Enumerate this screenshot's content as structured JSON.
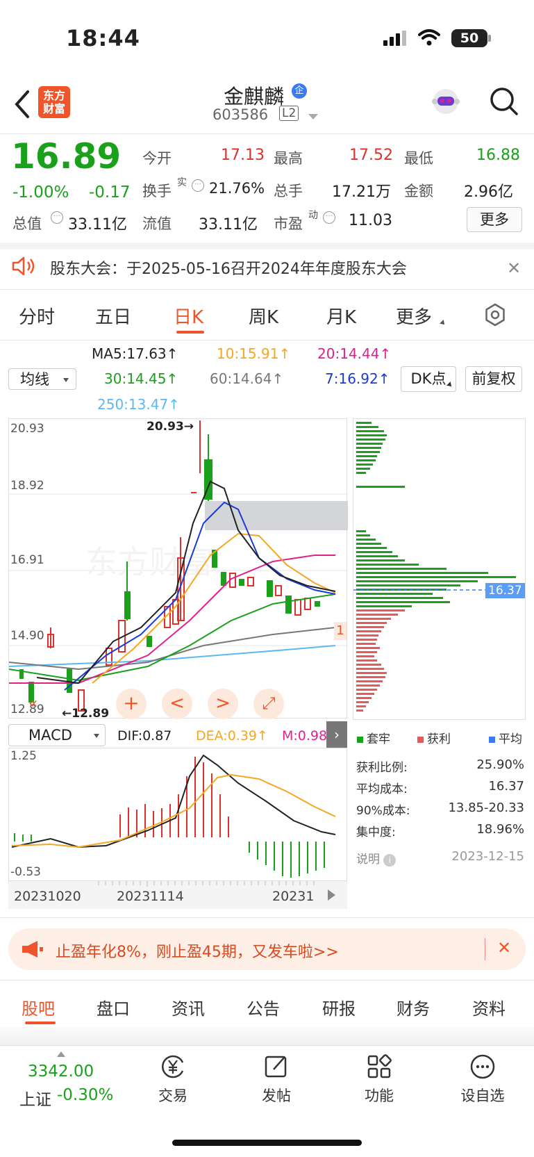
{
  "status_bar": {
    "time": "18:44",
    "battery": "50"
  },
  "header": {
    "logo_line1": "东方",
    "logo_line2": "财富",
    "stock_name": "金麒麟",
    "enterprise_badge": "企",
    "stock_code": "603586",
    "level_badge": "L2"
  },
  "quote": {
    "price": "16.89",
    "change_pct": "-1.00%",
    "change": "-0.17",
    "open_label": "今开",
    "open": "17.13",
    "high_label": "最高",
    "high": "17.52",
    "low_label": "最低",
    "low": "16.88",
    "turnover_label": "换手",
    "turnover_sup": "实",
    "turnover": "21.76%",
    "volume_label": "总手",
    "volume": "17.21万",
    "amount_label": "金额",
    "amount": "2.96亿",
    "mcap_label": "总值",
    "mcap": "33.11亿",
    "float_label": "流值",
    "float_mcap": "33.11亿",
    "pe_label": "市盈",
    "pe_sup": "动",
    "pe": "11.03",
    "more_button": "更多"
  },
  "notice": {
    "text": "股东大会：于2025-05-16召开2024年年度股东大会"
  },
  "period_tabs": [
    "分时",
    "五日",
    "日K",
    "周K",
    "月K",
    "更多"
  ],
  "active_period_tab": "日K",
  "ma_panel": {
    "selector": "均线",
    "ma5": "MA5:17.63",
    "ma10": "10:15.91",
    "ma20": "20:14.44",
    "ma30": "30:14.45",
    "ma60": "60:14.64",
    "ma7": "7:16.92",
    "ma250": "250:13.47",
    "dk_button": "DK点",
    "adjust_button": "前复权",
    "colors": {
      "ma5": "#222222",
      "ma10": "#f5a623",
      "ma20": "#e0218a",
      "ma30": "#1aa01a",
      "ma60": "#777777",
      "ma7": "#1a3ad6",
      "ma250": "#5bb8f0"
    }
  },
  "kline": {
    "y_ticks": [
      "20.93",
      "18.92",
      "16.91",
      "14.90",
      "12.89"
    ],
    "high_marker": "20.93",
    "low_marker": "12.89",
    "tag": "1",
    "watermark": "东方财富",
    "controls": [
      "+",
      "<",
      ">",
      "⤢"
    ]
  },
  "chip_distribution": {
    "avg_label": "16.37",
    "legend": [
      "套牢",
      "获利",
      "平均"
    ],
    "profit_ratio_label": "获利比例:",
    "profit_ratio": "25.90%",
    "avg_cost_label": "平均成本:",
    "avg_cost": "16.37",
    "cost90_label": "90%成本:",
    "cost90": "13.85-20.33",
    "concentration_label": "集中度:",
    "concentration": "18.96%",
    "note_label": "说明",
    "date": "2023-12-15"
  },
  "macd": {
    "selector": "MACD",
    "dif": "DIF:0.87",
    "dea": "DEA:0.39",
    "m": "M:0.98",
    "y_top": "1.25",
    "y_bottom": "-0.53"
  },
  "x_axis": {
    "labels": [
      "20231020",
      "20231114",
      "20231"
    ]
  },
  "promo": {
    "text": "止盈年化8%，刚止盈45期，又发车啦>>"
  },
  "bottom_tabs": [
    "股吧",
    "盘口",
    "资讯",
    "公告",
    "研报",
    "财务",
    "资料"
  ],
  "active_bottom_tab": "股吧",
  "dock": {
    "index_value": "3342.00",
    "index_name": "上证",
    "index_change": "-0.30%",
    "items": [
      "交易",
      "发帖",
      "功能",
      "设自选"
    ]
  }
}
